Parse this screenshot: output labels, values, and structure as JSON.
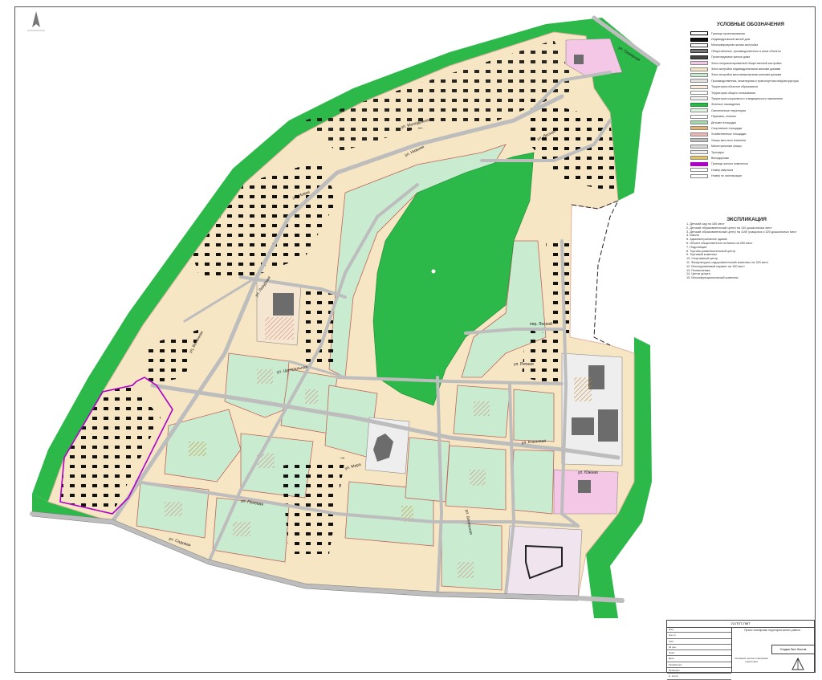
{
  "legend": {
    "title": "УСЛОВНЫЕ ОБОЗНАЧЕНИЯ",
    "items": [
      {
        "label": "Граница проектирования",
        "color": "#ffffff",
        "border": "#000000"
      },
      {
        "label": "Индивидуальный жилой дом",
        "color": "#111111",
        "border": "#000000"
      },
      {
        "label": "Многоквартирная жилая застройка",
        "color": "#ffffff",
        "border": "#333333"
      },
      {
        "label": "Общественные, производственные и иные объекты",
        "color": "#777777",
        "border": "#333333"
      },
      {
        "label": "Проектируемые жилые дома",
        "color": "#444444",
        "border": "#222222"
      },
      {
        "label": "Зона специализированной общественной застройки",
        "color": "#f4c7e6",
        "border": "#888888"
      },
      {
        "label": "Зона застройки индивидуальными жилыми домами",
        "color": "#f7e6c4",
        "border": "#888888"
      },
      {
        "label": "Зона застройки многоквартирными жилыми домами",
        "color": "#c9ebd0",
        "border": "#888888"
      },
      {
        "label": "Производственная, инженерная и транспортная инфраструктура",
        "color": "#e0e0e0",
        "border": "#888888"
      },
      {
        "label": "Территория объектов образования",
        "color": "#fbeedd",
        "border": "#888888"
      },
      {
        "label": "Территории общего пользования",
        "color": "#ffffff",
        "border": "#888888"
      },
      {
        "label": "Территория социального и медицинского назначения",
        "color": "#f0f0f0",
        "border": "#888888"
      },
      {
        "label": "Зеленые насаждения",
        "color": "#2db84a",
        "border": "#1a8a33"
      },
      {
        "label": "Озелененные территории",
        "color": "#dff5dd",
        "border": "#888888"
      },
      {
        "label": "Парковка, стоянки",
        "color": "#ffffff",
        "border": "#888888"
      },
      {
        "label": "Детские площадки",
        "color": "#9fdcab",
        "border": "#888888"
      },
      {
        "label": "Спортивные площадки",
        "color": "#e6b36b",
        "border": "#888888"
      },
      {
        "label": "Хозяйственные площадки",
        "color": "#f2b4b4",
        "border": "#888888"
      },
      {
        "label": "Улицы местного значения",
        "color": "#bdbdbd",
        "border": "#888888"
      },
      {
        "label": "Магистральные улицы",
        "color": "#d9d9d9",
        "border": "#888888"
      },
      {
        "label": "Тротуары",
        "color": "#eeeeee",
        "border": "#888888"
      },
      {
        "label": "Велодорожки",
        "color": "#e6c35a",
        "border": "#888888"
      },
      {
        "label": "Границы жилого комплекса",
        "color": "#b000c8",
        "border": "#b000c8"
      },
      {
        "label": "Номер квартала",
        "color": "#ffffff",
        "border": "#888888"
      },
      {
        "label": "Номер по экспликации",
        "color": "#ffffff",
        "border": "#888888"
      }
    ]
  },
  "explication": {
    "title": "ЭКСПЛИКАЦИЯ",
    "items": [
      "1. Детский сад на 180 мест",
      "2. Детский образовательный центр на 140 дошкольных мест",
      "3. Детский образовательный центр на 1100 учащихся и 320 дошкольных мест",
      "4. Школа",
      "5. Административное здание",
      "6. Объект общественного питания на 250 мест",
      "7. Подстанция",
      "8. Торгово-развлекательный центр",
      "9. Торговый комплекс",
      "10. Спортивный центр",
      "11. Физкультурно-оздоровительный комплекс на 320 мест",
      "12. Многоуровневый паркинг на 150 мест",
      "13. Поликлиника",
      "14. Центр досуга",
      "15. Многофункциональный комплекс"
    ]
  },
  "streets": {
    "s1": "ул. Молодежная",
    "s2": "ул. Новая",
    "s3": "ул. Лесная",
    "s4": "ул. Лазурная",
    "s5": "ул. Весенняя",
    "s6": "ул. Центральная",
    "s7": "ул. Мира",
    "s8": "ул. Полевая",
    "s9": "ул. Садовая",
    "s10": "ул. Речная",
    "s11": "пер. Лесной",
    "s12": "ул. Южная",
    "s13": "ул. Кленовая",
    "s14": "ул. Школьная",
    "s15": "ул. Нижняя",
    "s16": "ул. Северная"
  },
  "stamp": {
    "code": "22-ППТ-ПМТ",
    "rows": [
      "Изм.",
      "Кол.уч",
      "Лист",
      "№ док.",
      "Подп.",
      "Дата",
      "Разработал",
      "Проверил",
      "Н. контр."
    ],
    "project_title": "Проект планировки территории жилого района",
    "sheet_label": "Стадия  Лист  Листов",
    "sheet_title": "Основной чертеж планировки территории"
  },
  "colors": {
    "forest": "#2db84a",
    "residential_individual": "#f7e6c4",
    "residential_multi": "#c9ebd0",
    "road": "#bdbdbd",
    "boundary": "#b000c8",
    "public": "#f4c7e6"
  }
}
